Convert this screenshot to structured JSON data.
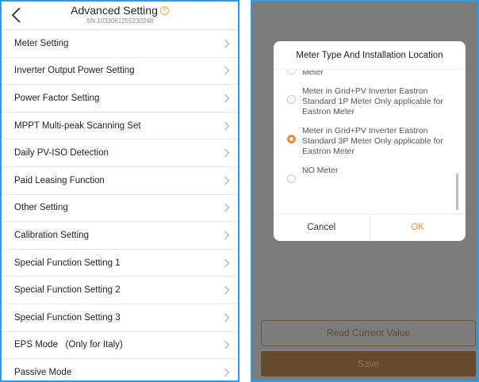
{
  "header": {
    "title": "Advanced Setting",
    "help_symbol": "?",
    "serial": "SN:1033061255230248"
  },
  "menu": {
    "items": [
      {
        "label": "Meter Setting"
      },
      {
        "label": "Inverter Output Power Setting"
      },
      {
        "label": "Power Factor Setting"
      },
      {
        "label": "MPPT Multi-peak Scanning Set"
      },
      {
        "label": "Daily PV-ISO Detection"
      },
      {
        "label": "Paid Leasing Function"
      },
      {
        "label": "Other Setting"
      },
      {
        "label": "Calibration Setting"
      },
      {
        "label": "Special Function Setting 1"
      },
      {
        "label": "Special Function Setting 2"
      },
      {
        "label": "Special Function Setting 3"
      },
      {
        "label": "EPS Mode   (Only for Italy)"
      },
      {
        "label": "Passive Mode"
      }
    ]
  },
  "dialog": {
    "title": "Meter Type And Installation Location",
    "options": [
      {
        "label": "Meter Only applicable for Eastron Meter",
        "selected": false
      },
      {
        "label": "Meter in Grid+PV Inverter Eastron Standard 1P Meter Only applicable for Eastron Meter",
        "selected": false
      },
      {
        "label": "Meter in Grid+PV Inverter Eastron Standard 3P Meter Only applicable for Eastron Meter",
        "selected": true
      },
      {
        "label": "NO Meter",
        "selected": false
      }
    ],
    "cancel_label": "Cancel",
    "ok_label": "OK"
  },
  "actions": {
    "read_label": "Read Current Value",
    "save_label": "Save"
  },
  "colors": {
    "panel_border": "#2f9be6",
    "accent": "#f0893a",
    "overlay": "#7c7c7c",
    "save_button": "#664a2c"
  }
}
